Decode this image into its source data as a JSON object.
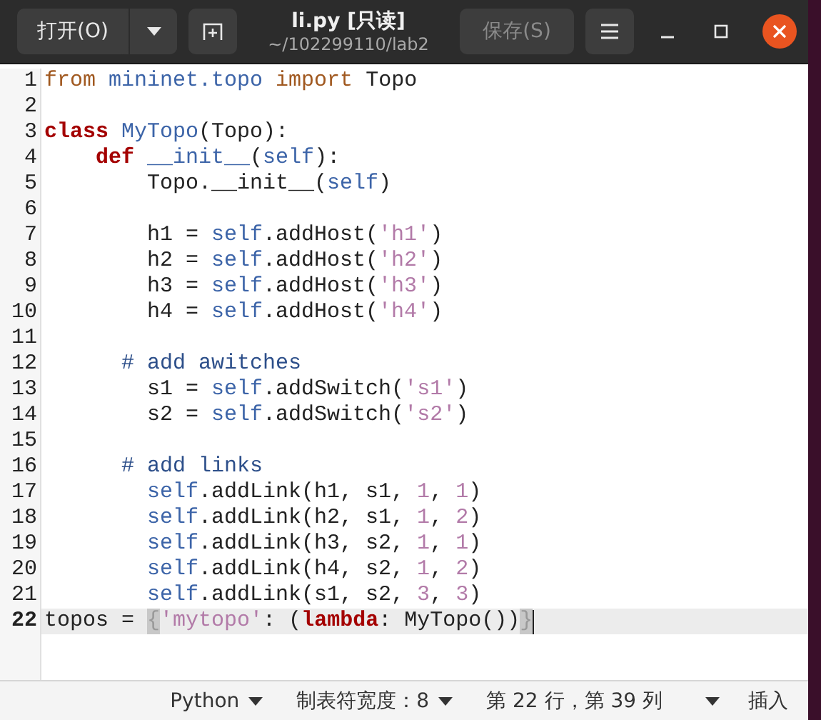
{
  "header": {
    "open_button": "打开(O)",
    "title": "li.py [只读]",
    "subtitle": "~/102299110/lab2",
    "save_button": {
      "label": "保存(S)",
      "disabled": true
    }
  },
  "editor": {
    "lines": [
      {
        "number": "1",
        "current": false,
        "kind": "top",
        "tokens": [
          {
            "kind": "import",
            "text": "from "
          },
          {
            "kind": "ident",
            "text": "mininet.topo "
          },
          {
            "kind": "import",
            "text": "import "
          },
          {
            "kind": "plain",
            "text": "Topo"
          }
        ]
      },
      {
        "number": "2",
        "current": false
      },
      {
        "number": "3",
        "current": false,
        "kind": "top",
        "tokens": [
          {
            "kind": "keyword",
            "text": "class "
          },
          {
            "kind": "ident",
            "text": "MyTopo"
          },
          {
            "kind": "plain",
            "text": "(Topo):"
          }
        ]
      },
      {
        "number": "4",
        "current": false,
        "kind": "method",
        "tokens": [
          {
            "kind": "keyword",
            "text": "def "
          },
          {
            "kind": "ident",
            "text": "__init__"
          },
          {
            "kind": "plain",
            "text": "("
          },
          {
            "kind": "ident",
            "text": "self"
          },
          {
            "kind": "plain",
            "text": "):"
          }
        ]
      },
      {
        "number": "5",
        "current": false,
        "kind": "body",
        "tokens": [
          {
            "kind": "plain",
            "text": "Topo.__init__("
          },
          {
            "kind": "ident",
            "text": "self"
          },
          {
            "kind": "plain",
            "text": ")"
          }
        ]
      },
      {
        "number": "6",
        "current": false
      },
      {
        "number": "7",
        "current": false,
        "kind": "body",
        "tokens": [
          {
            "kind": "plain",
            "text": "h1 = "
          },
          {
            "kind": "ident",
            "text": "self"
          },
          {
            "kind": "plain",
            "text": ".addHost("
          },
          {
            "kind": "string",
            "text": "'h1'"
          },
          {
            "kind": "plain",
            "text": ")"
          }
        ]
      },
      {
        "number": "8",
        "current": false,
        "kind": "body",
        "tokens": [
          {
            "kind": "plain",
            "text": "h2 = "
          },
          {
            "kind": "ident",
            "text": "self"
          },
          {
            "kind": "plain",
            "text": ".addHost("
          },
          {
            "kind": "string",
            "text": "'h2'"
          },
          {
            "kind": "plain",
            "text": ")"
          }
        ]
      },
      {
        "number": "9",
        "current": false,
        "kind": "body",
        "tokens": [
          {
            "kind": "plain",
            "text": "h3 = "
          },
          {
            "kind": "ident",
            "text": "self"
          },
          {
            "kind": "plain",
            "text": ".addHost("
          },
          {
            "kind": "string",
            "text": "'h3'"
          },
          {
            "kind": "plain",
            "text": ")"
          }
        ]
      },
      {
        "number": "10",
        "current": false,
        "kind": "body",
        "tokens": [
          {
            "kind": "plain",
            "text": "h4 = "
          },
          {
            "kind": "ident",
            "text": "self"
          },
          {
            "kind": "plain",
            "text": ".addHost("
          },
          {
            "kind": "string",
            "text": "'h4'"
          },
          {
            "kind": "plain",
            "text": ")"
          }
        ]
      },
      {
        "number": "11",
        "current": false
      },
      {
        "number": "12",
        "current": false,
        "kind": "comment",
        "tokens": [
          {
            "kind": "comment",
            "text": "# add awitches"
          }
        ]
      },
      {
        "number": "13",
        "current": false,
        "kind": "body",
        "tokens": [
          {
            "kind": "plain",
            "text": "s1 = "
          },
          {
            "kind": "ident",
            "text": "self"
          },
          {
            "kind": "plain",
            "text": ".addSwitch("
          },
          {
            "kind": "string",
            "text": "'s1'"
          },
          {
            "kind": "plain",
            "text": ")"
          }
        ]
      },
      {
        "number": "14",
        "current": false,
        "kind": "body",
        "tokens": [
          {
            "kind": "plain",
            "text": "s2 = "
          },
          {
            "kind": "ident",
            "text": "self"
          },
          {
            "kind": "plain",
            "text": ".addSwitch("
          },
          {
            "kind": "string",
            "text": "'s2'"
          },
          {
            "kind": "plain",
            "text": ")"
          }
        ]
      },
      {
        "number": "15",
        "current": false
      },
      {
        "number": "16",
        "current": false,
        "kind": "comment",
        "tokens": [
          {
            "kind": "comment",
            "text": "# add links"
          }
        ]
      },
      {
        "number": "17",
        "current": false,
        "kind": "body",
        "tokens": [
          {
            "kind": "ident",
            "text": "self"
          },
          {
            "kind": "plain",
            "text": ".addLink(h1, s1, "
          },
          {
            "kind": "number",
            "text": "1"
          },
          {
            "kind": "plain",
            "text": ", "
          },
          {
            "kind": "number",
            "text": "1"
          },
          {
            "kind": "plain",
            "text": ")"
          }
        ]
      },
      {
        "number": "18",
        "current": false,
        "kind": "body",
        "tokens": [
          {
            "kind": "ident",
            "text": "self"
          },
          {
            "kind": "plain",
            "text": ".addLink(h2, s1, "
          },
          {
            "kind": "number",
            "text": "1"
          },
          {
            "kind": "plain",
            "text": ", "
          },
          {
            "kind": "number",
            "text": "2"
          },
          {
            "kind": "plain",
            "text": ")"
          }
        ]
      },
      {
        "number": "19",
        "current": false,
        "kind": "body",
        "tokens": [
          {
            "kind": "ident",
            "text": "self"
          },
          {
            "kind": "plain",
            "text": ".addLink(h3, s2, "
          },
          {
            "kind": "number",
            "text": "1"
          },
          {
            "kind": "plain",
            "text": ", "
          },
          {
            "kind": "number",
            "text": "1"
          },
          {
            "kind": "plain",
            "text": ")"
          }
        ]
      },
      {
        "number": "20",
        "current": false,
        "kind": "body",
        "tokens": [
          {
            "kind": "ident",
            "text": "self"
          },
          {
            "kind": "plain",
            "text": ".addLink(h4, s2, "
          },
          {
            "kind": "number",
            "text": "1"
          },
          {
            "kind": "plain",
            "text": ", "
          },
          {
            "kind": "number",
            "text": "2"
          },
          {
            "kind": "plain",
            "text": ")"
          }
        ]
      },
      {
        "number": "21",
        "current": false,
        "kind": "body",
        "tokens": [
          {
            "kind": "ident",
            "text": "self"
          },
          {
            "kind": "plain",
            "text": ".addLink(s1, s2, "
          },
          {
            "kind": "number",
            "text": "3"
          },
          {
            "kind": "plain",
            "text": ", "
          },
          {
            "kind": "number",
            "text": "3"
          },
          {
            "kind": "plain",
            "text": ")"
          }
        ]
      },
      {
        "number": "22",
        "current": true,
        "kind": "top",
        "tokens": [
          {
            "kind": "plain",
            "text": "topos = "
          },
          {
            "kind": "match",
            "text": "{"
          },
          {
            "kind": "string",
            "text": "'mytopo'"
          },
          {
            "kind": "plain",
            "text": ": ("
          },
          {
            "kind": "keyword",
            "text": "lambda"
          },
          {
            "kind": "plain",
            "text": ": MyTopo())"
          },
          {
            "kind": "match",
            "text": "}"
          }
        ]
      }
    ]
  },
  "status_bar": {
    "language": "Python",
    "tab_width": "制表符宽度：8",
    "position": "第 22 行，第 39 列",
    "mode": "插入"
  }
}
